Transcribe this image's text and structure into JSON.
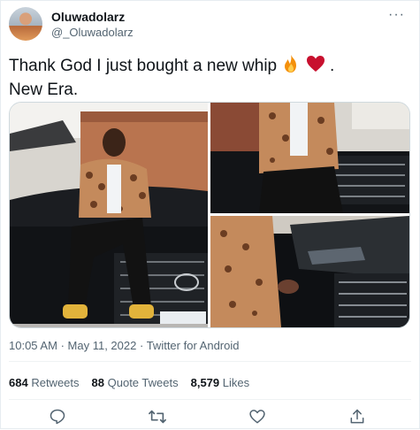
{
  "tweet": {
    "author_name": "Oluwadolarz",
    "author_handle": "@_Oluwadolarz",
    "more_glyph": "···",
    "text_line1": "Thank God I just bought a new whip",
    "text_line1_end": ".",
    "text_line2": "New Era.",
    "emojis": [
      "fire-emoji",
      "red-heart-emoji"
    ],
    "media_count": 3,
    "time": "10:05 AM",
    "separator": "·",
    "date": "May 11, 2022",
    "source": "Twitter for Android"
  },
  "stats": {
    "retweets_count": "684",
    "retweets_label": "Retweets",
    "quotes_count": "88",
    "quotes_label": "Quote Tweets",
    "likes_count": "8,579",
    "likes_label": "Likes"
  },
  "actions": [
    "reply-icon",
    "retweet-icon",
    "like-icon",
    "share-icon"
  ],
  "colors": {
    "text": "#0f1419",
    "muted": "#536471",
    "border": "#cfd9de",
    "heart": "#c8102e"
  }
}
